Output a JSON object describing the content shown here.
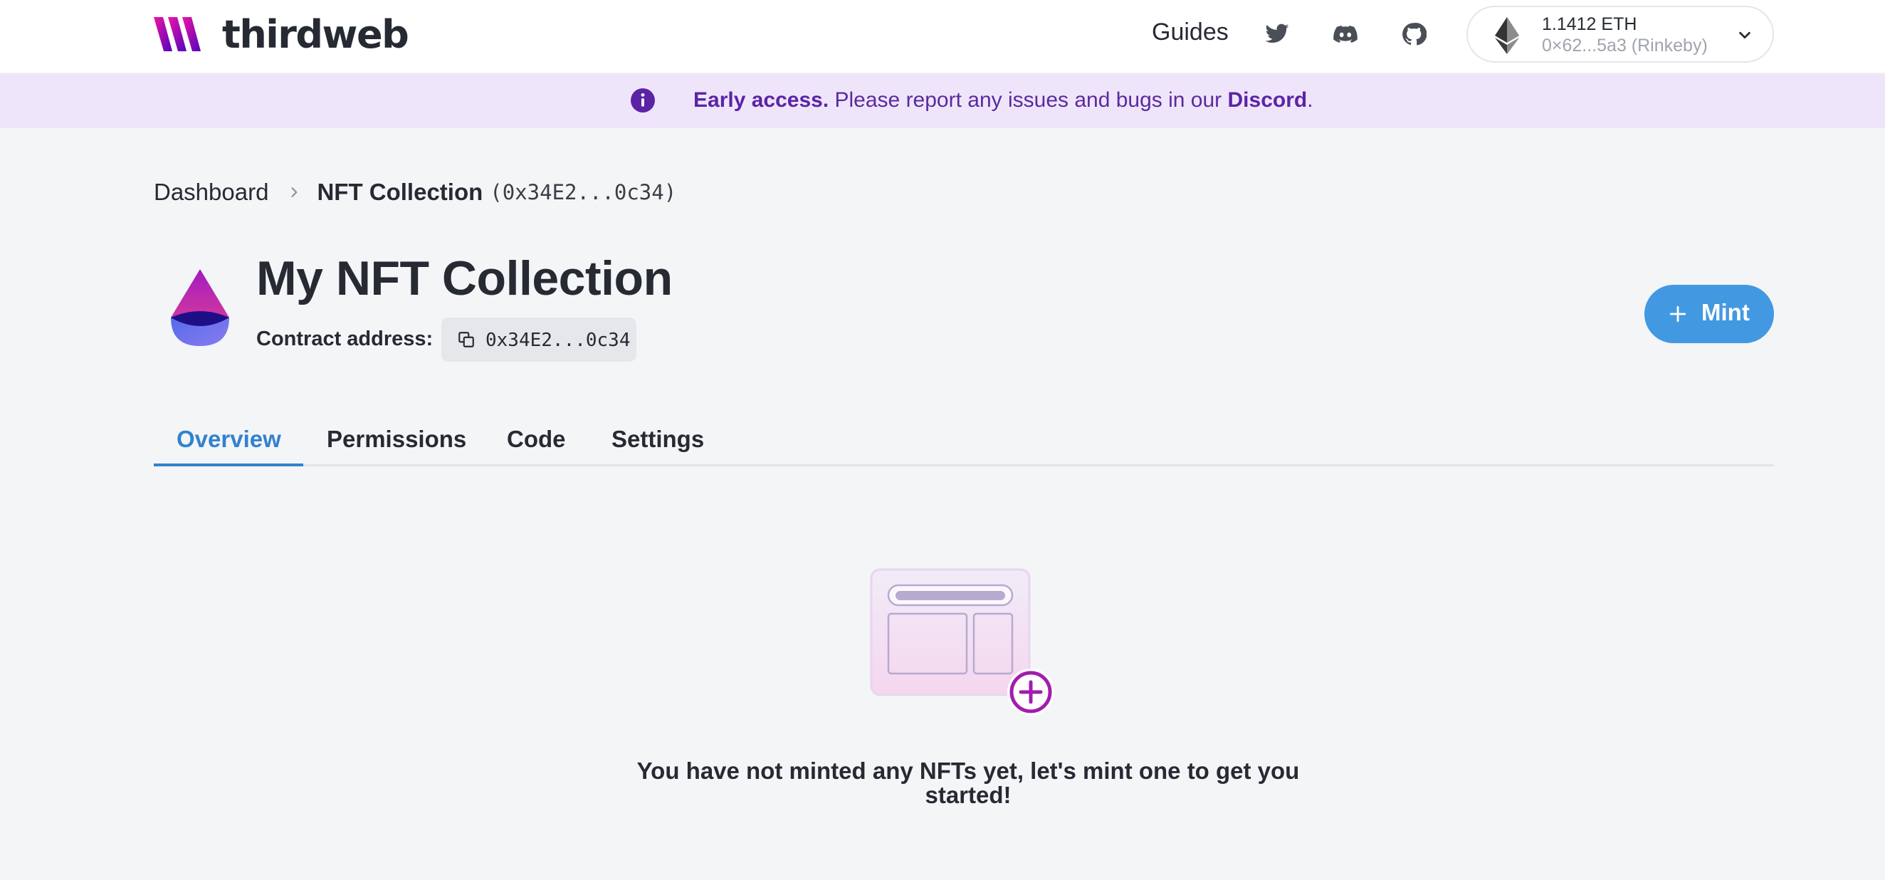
{
  "header": {
    "logo_text": "thirdweb",
    "nav": {
      "guides_label": "Guides",
      "icons": [
        "twitter-icon",
        "discord-icon",
        "github-icon"
      ]
    },
    "wallet": {
      "balance": "1.1412 ETH",
      "address_network": "0×62...5a3 (Rinkeby)"
    }
  },
  "banner": {
    "lead": "Early access.",
    "text": " Please report any issues and bugs in our ",
    "link": "Discord",
    "trail": "."
  },
  "breadcrumb": {
    "root": "Dashboard",
    "current": "NFT Collection",
    "current_address": "(0x34E2...0c34)"
  },
  "collection": {
    "title": "My NFT Collection",
    "contract_label": "Contract address:",
    "contract_address": "0x34E2...0c34"
  },
  "actions": {
    "mint_label": "Mint"
  },
  "tabs": [
    {
      "label": "Overview",
      "active": true
    },
    {
      "label": "Permissions",
      "active": false
    },
    {
      "label": "Code",
      "active": false
    },
    {
      "label": "Settings",
      "active": false
    }
  ],
  "empty_state": {
    "line1": "You have not minted any NFTs yet, let's mint one to get you",
    "line2": "started!"
  },
  "colors": {
    "accent": "#3182ce",
    "mint_button": "#4299e1",
    "banner_bg": "#efe5fb",
    "banner_text": "#5b24a6",
    "page_bg": "#f4f5f7"
  }
}
